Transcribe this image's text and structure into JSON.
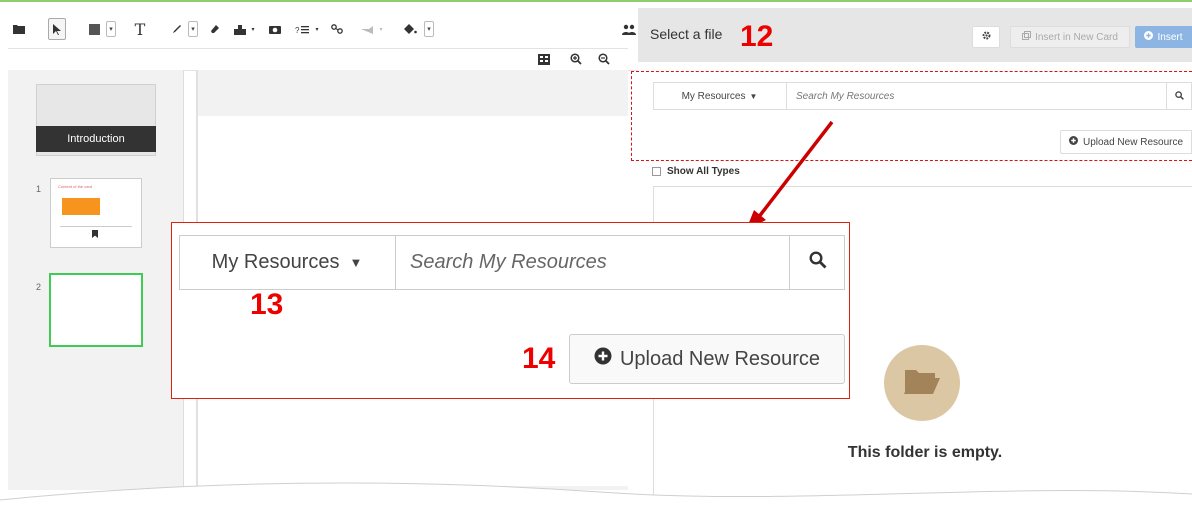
{
  "toolbar": {
    "icons": [
      "folder-icon",
      "pointer-icon",
      "shape-icon",
      "text-icon",
      "pen-icon",
      "eraser-icon",
      "stamp-icon",
      "camera-icon",
      "list-icon",
      "link-icon",
      "hand-icon",
      "fill-icon"
    ],
    "text_tool": "T",
    "zoom_icons": [
      "grid-icon",
      "zoom-in-icon",
      "zoom-out-icon"
    ]
  },
  "slides": {
    "intro_label": "Introduction",
    "items": [
      {
        "number": "1",
        "title": "Content of the card"
      },
      {
        "number": "2"
      }
    ]
  },
  "file_panel": {
    "title": "Select a file",
    "insert_new_card": "Insert in New Card",
    "insert": "Insert",
    "resources_dropdown": "My Resources",
    "search_placeholder": "Search My Resources",
    "upload": "Upload New Resource",
    "show_all_types": "Show All Types",
    "empty_message": "This folder is empty."
  },
  "annotations": {
    "n12": "12",
    "n13": "13",
    "n14": "14"
  },
  "colors": {
    "callout_red": "#dd1111",
    "slide_selected": "#3fcc52",
    "folder_tan": "#dcc7a5",
    "insert_blue": "#8db5e4",
    "orange_bar": "#f7941d"
  }
}
